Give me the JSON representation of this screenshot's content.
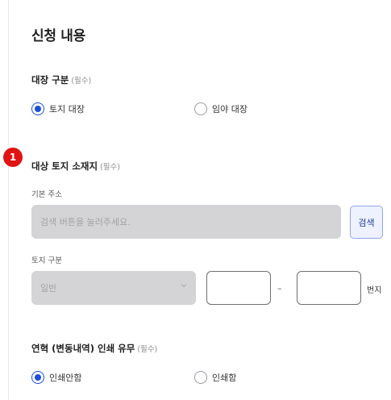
{
  "page_title": "신청 내용",
  "register_type": {
    "title": "대장 구분",
    "required": "(필수)",
    "options": [
      {
        "label": "토지 대장",
        "selected": true
      },
      {
        "label": "임야 대장",
        "selected": false
      }
    ]
  },
  "location": {
    "step_badge": "1",
    "title": "대상 토지 소재지",
    "required": "(필수)",
    "address_label": "기본 주소",
    "address_placeholder": "검색 버튼을 눌러주세요.",
    "search_button": "검색",
    "land_type_label": "토지 구분",
    "land_type_value": "일반",
    "lot_separator": "–",
    "lot_unit": "번지"
  },
  "print_history": {
    "title": "연혁 (변동내역) 인쇄 유무",
    "required": "(필수)",
    "options": [
      {
        "label": "인쇄안함",
        "selected": true
      },
      {
        "label": "인쇄함",
        "selected": false
      }
    ]
  },
  "colors": {
    "accent": "#1e4fd8",
    "badge": "#e01414",
    "disabled": "#d4d4d6"
  }
}
